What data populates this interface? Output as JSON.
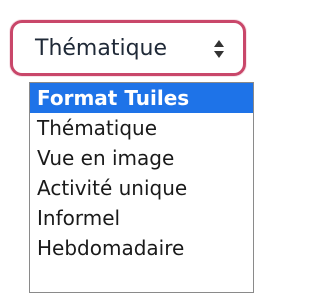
{
  "select": {
    "value": "Thématique",
    "border_color": "#c9476a"
  },
  "dropdown": {
    "options": [
      "Format Tuiles",
      "Thématique",
      "Vue en image",
      "Activité unique",
      "Informel",
      "Hebdomadaire"
    ],
    "highlighted": "Format Tuiles",
    "highlight_color": "#1e73e8"
  }
}
